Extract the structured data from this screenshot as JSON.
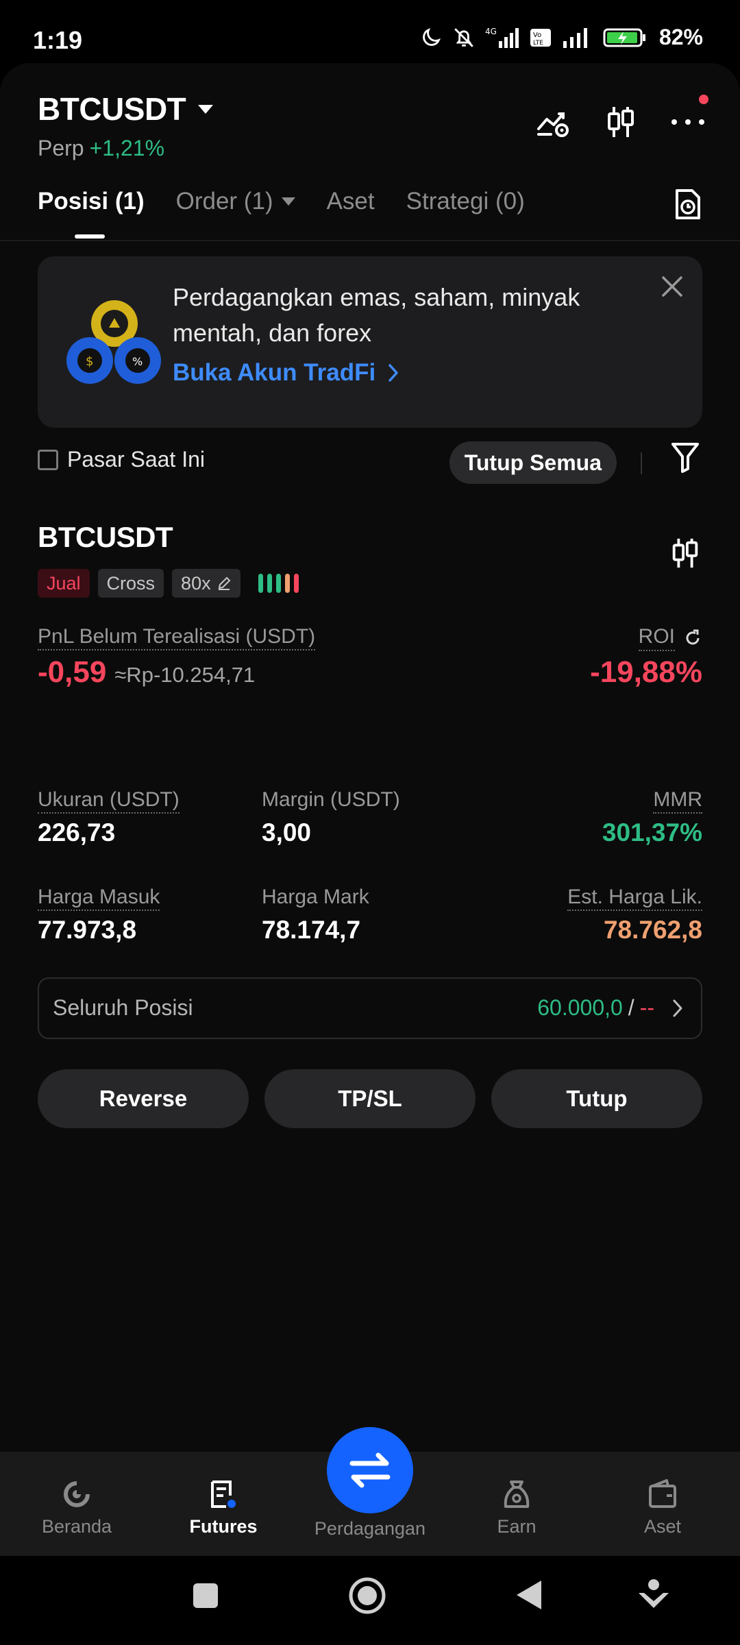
{
  "status_bar": {
    "time": "1:19",
    "battery": "82%"
  },
  "header": {
    "symbol": "BTCUSDT",
    "type": "Perp",
    "change": "+1,21%"
  },
  "tabs": [
    {
      "label": "Posisi (1)"
    },
    {
      "label": "Order (1)"
    },
    {
      "label": "Aset"
    },
    {
      "label": "Strategi (0)"
    }
  ],
  "promo": {
    "text": "Perdagangkan emas, saham, minyak mentah, dan forex",
    "link": "Buka Akun TradFi"
  },
  "filter": {
    "current_market": "Pasar Saat Ini",
    "close_all": "Tutup Semua"
  },
  "position": {
    "symbol": "BTCUSDT",
    "side": "Jual",
    "margin_mode": "Cross",
    "leverage": "80x",
    "pnl_label": "PnL Belum Terealisasi (USDT)",
    "pnl_value": "-0,59",
    "pnl_idr": "≈Rp-10.254,71",
    "roi_label": "ROI",
    "roi_value": "-19,88%",
    "size_label": "Ukuran (USDT)",
    "size_value": "226,73",
    "margin_label": "Margin (USDT)",
    "margin_value": "3,00",
    "mmr_label": "MMR",
    "mmr_value": "301,37%",
    "entry_label": "Harga Masuk",
    "entry_value": "77.973,8",
    "mark_label": "Harga Mark",
    "mark_value": "78.174,7",
    "liq_label": "Est. Harga Lik.",
    "liq_value": "78.762,8",
    "whole_label": "Seluruh Posisi",
    "whole_value": "60.000,0",
    "whole_sep": "/",
    "whole_extra": "--"
  },
  "actions": {
    "reverse": "Reverse",
    "tpsl": "TP/SL",
    "close": "Tutup"
  },
  "bottom_nav": {
    "home": "Beranda",
    "futures": "Futures",
    "trade": "Perdagangan",
    "earn": "Earn",
    "assets": "Aset"
  },
  "colors": {
    "up": "#2ebd85",
    "down": "#f6465d",
    "accent": "#1463ff",
    "link": "#3e8cff",
    "liq": "#f0a070"
  }
}
